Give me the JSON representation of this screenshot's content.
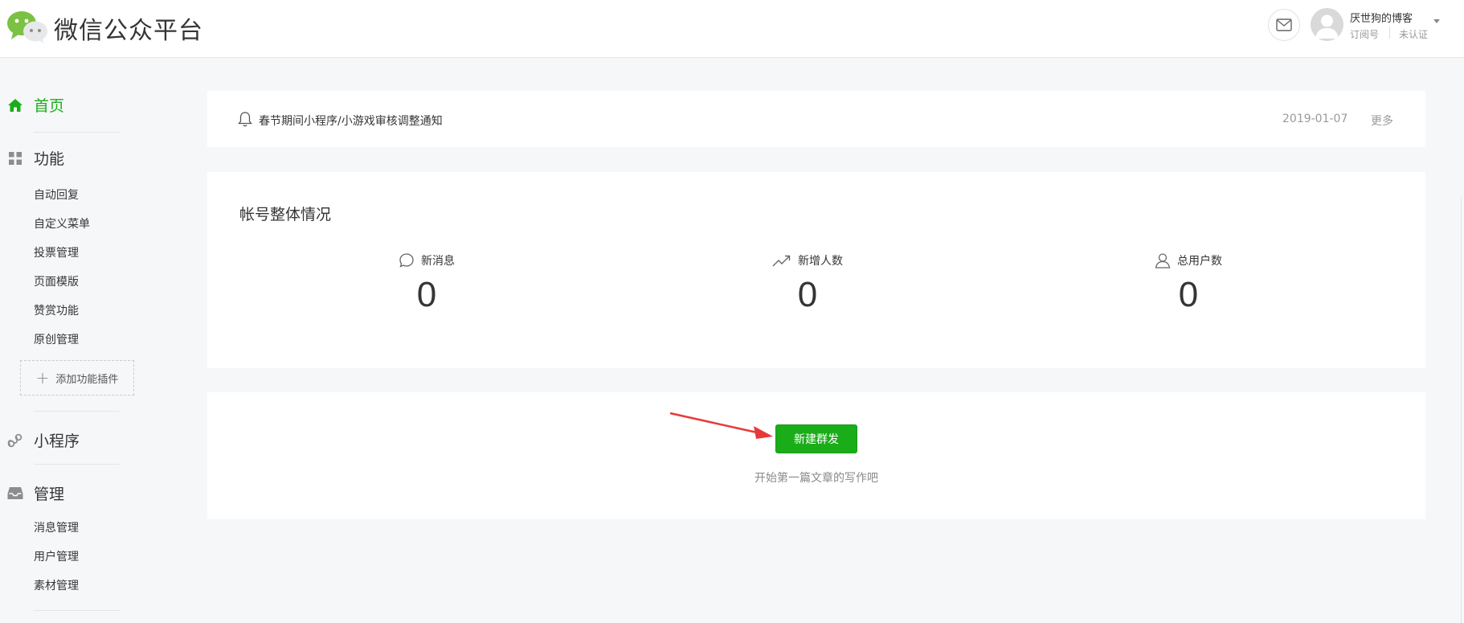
{
  "header": {
    "brand": "微信公众平台",
    "account_name": "厌世狗的博客",
    "account_type": "订阅号",
    "account_status": "未认证"
  },
  "sidebar": {
    "home": "首页",
    "features": {
      "label": "功能",
      "items": [
        "自动回复",
        "自定义菜单",
        "投票管理",
        "页面模版",
        "赞赏功能",
        "原创管理"
      ],
      "add_plugin": "添加功能插件"
    },
    "miniprogram": "小程序",
    "management": {
      "label": "管理",
      "items": [
        "消息管理",
        "用户管理",
        "素材管理"
      ]
    }
  },
  "notice": {
    "text": "春节期间小程序/小游戏审核调整通知",
    "date": "2019-01-07",
    "more": "更多"
  },
  "overview": {
    "title": "帐号整体情况",
    "stats": [
      {
        "label": "新消息",
        "value": "0",
        "icon": "chat-bubble-icon"
      },
      {
        "label": "新增人数",
        "value": "0",
        "icon": "trend-up-icon"
      },
      {
        "label": "总用户数",
        "value": "0",
        "icon": "user-icon"
      }
    ]
  },
  "compose": {
    "button": "新建群发",
    "hint": "开始第一篇文章的写作吧"
  },
  "colors": {
    "accent": "#1aad19",
    "arrow": "#e8393a"
  }
}
